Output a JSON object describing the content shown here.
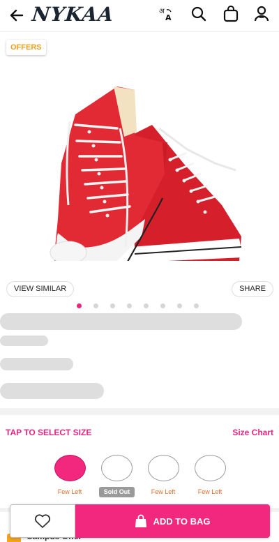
{
  "header": {
    "logo_text": "NYKAA",
    "icons": [
      "back-arrow-icon",
      "translate-icon",
      "search-icon",
      "bag-icon",
      "account-icon"
    ]
  },
  "product": {
    "offers_label": "OFFERS",
    "view_similar_label": "VIEW SIMILAR",
    "share_label": "SHARE",
    "image_dots": {
      "count": 8,
      "active_index": 0
    }
  },
  "size": {
    "title": "TAP TO SELECT SIZE",
    "chart_label": "Size Chart",
    "options": [
      {
        "status": "Few Left",
        "selected": true
      },
      {
        "status": "Sold Out",
        "selected": false
      },
      {
        "status": "Few Left",
        "selected": false
      },
      {
        "status": "Few Left",
        "selected": false
      }
    ]
  },
  "partial_banner": {
    "text": "Campus Offer"
  },
  "actions": {
    "add_to_bag_label": "ADD TO BAG"
  },
  "colors": {
    "accent": "#f2277e",
    "offers": "#f0a020",
    "few_left": "#e76a2a"
  }
}
